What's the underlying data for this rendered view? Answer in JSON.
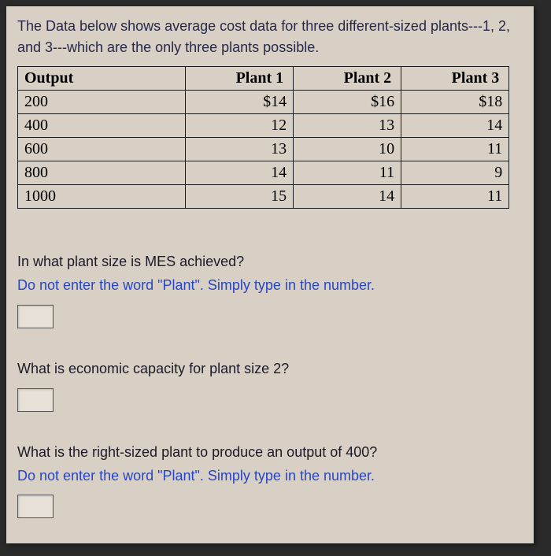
{
  "intro": "The Data below shows average cost data for three different-sized plants---1, 2, and 3---which are the only three plants possible.",
  "table": {
    "headers": [
      "Output",
      "Plant 1",
      "Plant 2",
      "Plant 3"
    ],
    "rows": [
      {
        "output": "200",
        "p1": "$14",
        "p2": "$16",
        "p3": "$18"
      },
      {
        "output": "400",
        "p1": "12",
        "p2": "13",
        "p3": "14"
      },
      {
        "output": "600",
        "p1": "13",
        "p2": "10",
        "p3": "11"
      },
      {
        "output": "800",
        "p1": "14",
        "p2": "11",
        "p3": "9"
      },
      {
        "output": "1000",
        "p1": "15",
        "p2": "14",
        "p3": "11"
      }
    ]
  },
  "q1": {
    "prompt": "In what plant size is MES achieved?",
    "hint": "Do not enter the word \"Plant\". Simply type in the number.",
    "value": ""
  },
  "q2": {
    "prompt": "What is economic capacity for plant size 2?",
    "value": ""
  },
  "q3": {
    "prompt": "What is the right-sized plant to produce an output of 400?",
    "hint": "Do not enter the word \"Plant\". Simply type in the number.",
    "value": ""
  }
}
